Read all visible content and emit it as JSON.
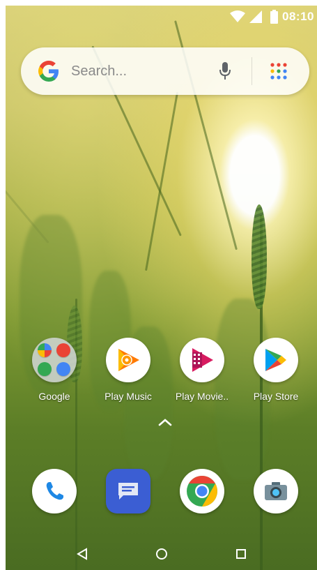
{
  "status_bar": {
    "time": "08:10",
    "icons": [
      "wifi-icon",
      "cell-signal-icon",
      "battery-icon"
    ]
  },
  "search": {
    "placeholder": "Search...",
    "logo": "google-g-icon",
    "mic_icon": "mic-icon",
    "apps_icon": "app-drawer-icon"
  },
  "home_apps": [
    {
      "label": "Google",
      "icon": "google-folder-icon"
    },
    {
      "label": "Play Music",
      "icon": "play-music-icon"
    },
    {
      "label": "Play Movie..",
      "icon": "play-movies-icon"
    },
    {
      "label": "Play Store",
      "icon": "play-store-icon"
    }
  ],
  "dock_apps": [
    {
      "name": "Phone",
      "icon": "phone-icon"
    },
    {
      "name": "Messages",
      "icon": "messages-icon"
    },
    {
      "name": "Chrome",
      "icon": "chrome-icon"
    },
    {
      "name": "Camera",
      "icon": "camera-icon"
    }
  ],
  "navigation": [
    "back-icon",
    "home-icon",
    "recents-icon"
  ],
  "colors": {
    "google_blue": "#4285F4",
    "google_red": "#EA4335",
    "google_yellow": "#FBBC05",
    "google_green": "#34A853",
    "messages_blue": "#3b5ed3"
  }
}
